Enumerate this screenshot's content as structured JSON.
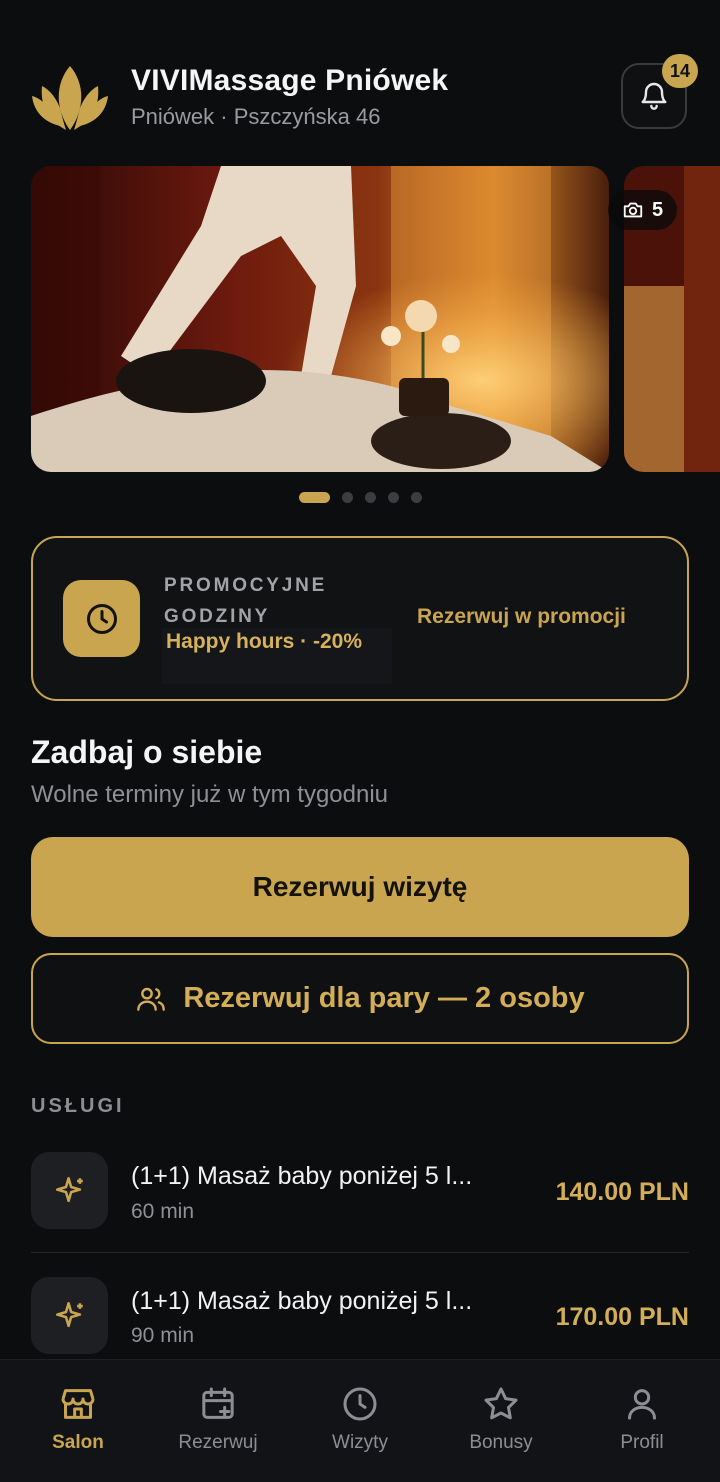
{
  "header": {
    "title": "VIVIMassage Pniówek",
    "subtitle": "Pniówek · Pszczyńska 46",
    "notifications_count": "14"
  },
  "gallery": {
    "photo_count": "5",
    "total_dots": 5,
    "active_index": 0
  },
  "promo": {
    "label": "PROMOCYJNE GODZINY",
    "subtitle": "Happy hours · -20%",
    "cta": "Rezerwuj w promocji"
  },
  "booking": {
    "title": "Zadbaj o siebie",
    "subtitle": "Wolne terminy już w tym tygodniu",
    "primary_button": "Rezerwuj wizytę",
    "pair_button": "Rezerwuj dla pary — 2 osoby"
  },
  "services": {
    "heading": "USŁUGI",
    "items": [
      {
        "name": "(1+1) Masaż baby poniżej 5 l...",
        "duration": "60 min",
        "price": "140.00 PLN"
      },
      {
        "name": "(1+1) Masaż baby poniżej 5 l...",
        "duration": "90 min",
        "price": "170.00 PLN"
      }
    ]
  },
  "nav": {
    "items": [
      {
        "label": "Salon",
        "icon": "store-icon",
        "active": true
      },
      {
        "label": "Rezerwuj",
        "icon": "calendar-plus-icon",
        "active": false
      },
      {
        "label": "Wizyty",
        "icon": "clock-icon",
        "active": false
      },
      {
        "label": "Bonusy",
        "icon": "star-icon",
        "active": false
      },
      {
        "label": "Profil",
        "icon": "user-icon",
        "active": false
      }
    ]
  },
  "colors": {
    "accent": "#c9a550",
    "background": "#0c0d0f",
    "muted_text": "#8f9095"
  }
}
